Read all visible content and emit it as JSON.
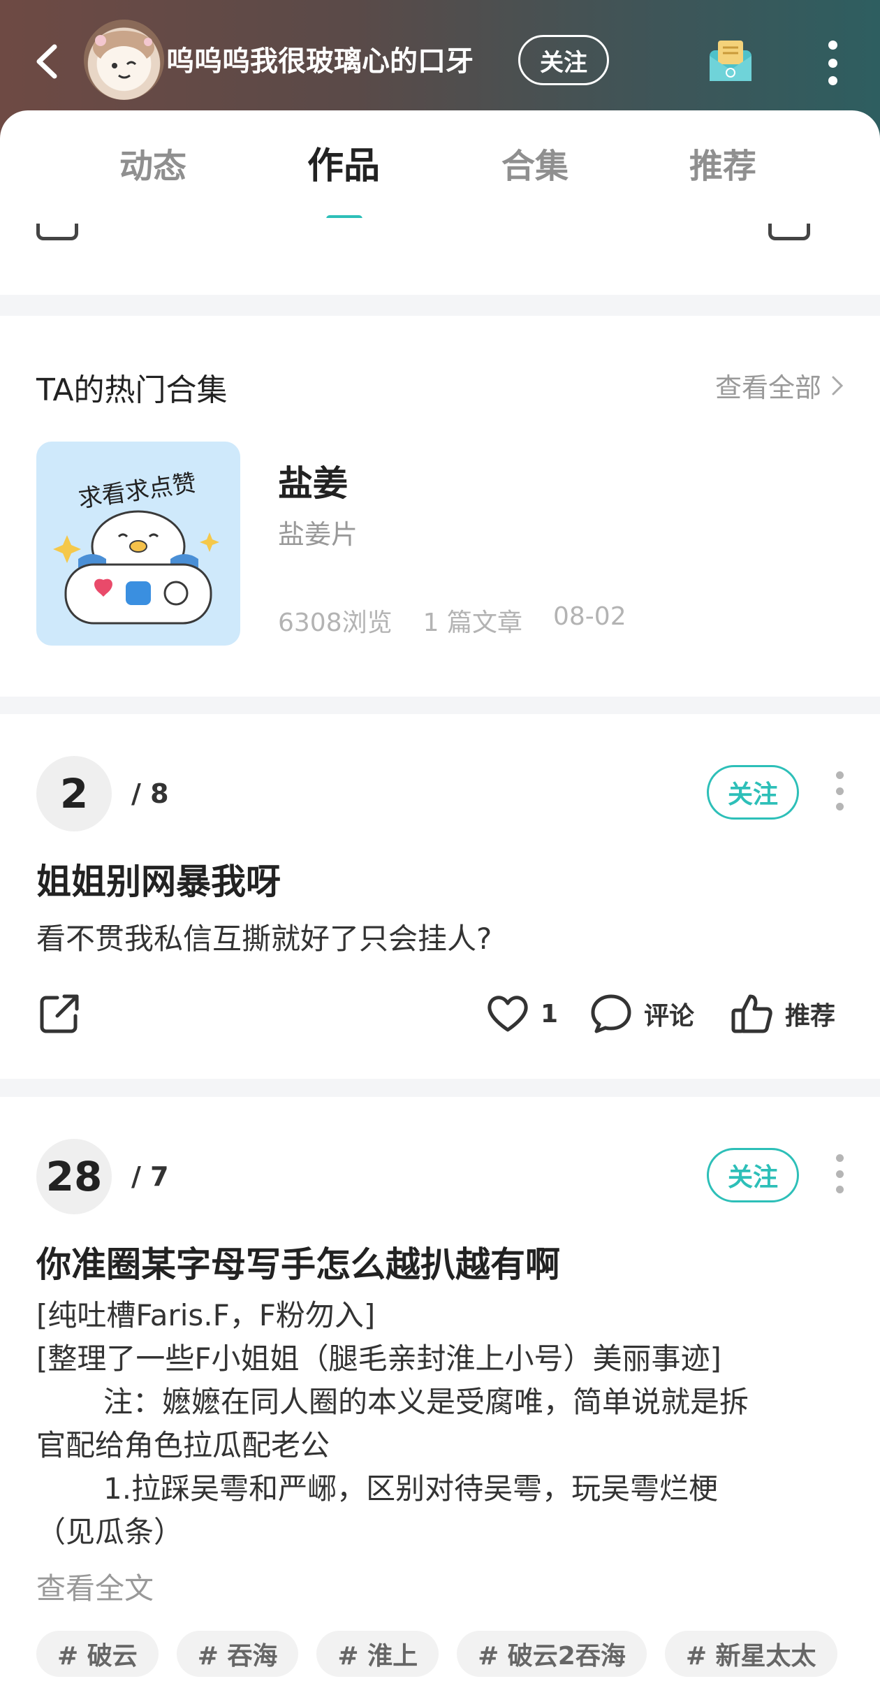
{
  "header": {
    "username": "呜呜呜我很玻璃心的口牙",
    "follow_label": "关注"
  },
  "tabs": [
    {
      "label": "动态"
    },
    {
      "label": "作品"
    },
    {
      "label": "合集"
    },
    {
      "label": "推荐"
    }
  ],
  "active_tab": "作品",
  "hot_collection": {
    "section_title": "TA的热门合集",
    "see_all_label": "查看全部",
    "cover_text": "求看求点赞",
    "name": "盐姜",
    "description": "盐姜片",
    "views": "6308浏览",
    "article_count": "1 篇文章",
    "date": "08-02"
  },
  "posts": [
    {
      "rank": "2",
      "total": "/ 8",
      "follow_label": "关注",
      "title": "姐姐别网暴我呀",
      "summary": "看不贯我私信互撕就好了只会挂人?",
      "likes": "1",
      "comment_label": "评论",
      "recommend_label": "推荐"
    },
    {
      "rank": "28",
      "total": "/ 7",
      "follow_label": "关注",
      "title": "你准圈某字母写手怎么越扒越有啊",
      "lines": [
        "[纯吐槽Faris.F，F粉勿入]",
        "[整理了一些F小姐姐（腿毛亲封淮上小号）美丽事迹]",
        "注：嬷嬷在同人圈的本义是受腐唯，简单说就是拆",
        "官配给角色拉瓜配老公",
        "1.拉踩吴雩和严峫，区别对待吴雩，玩吴雩烂梗",
        "（见瓜条）"
      ],
      "read_more": "查看全文",
      "tags": [
        "# 破云",
        "# 吞海",
        "# 淮上",
        "# 破云2吞海",
        "# 新星太太"
      ]
    }
  ],
  "colors": {
    "accent": "#2dbfb8",
    "header_start": "#6e4a44",
    "header_end": "#2e5e60"
  }
}
